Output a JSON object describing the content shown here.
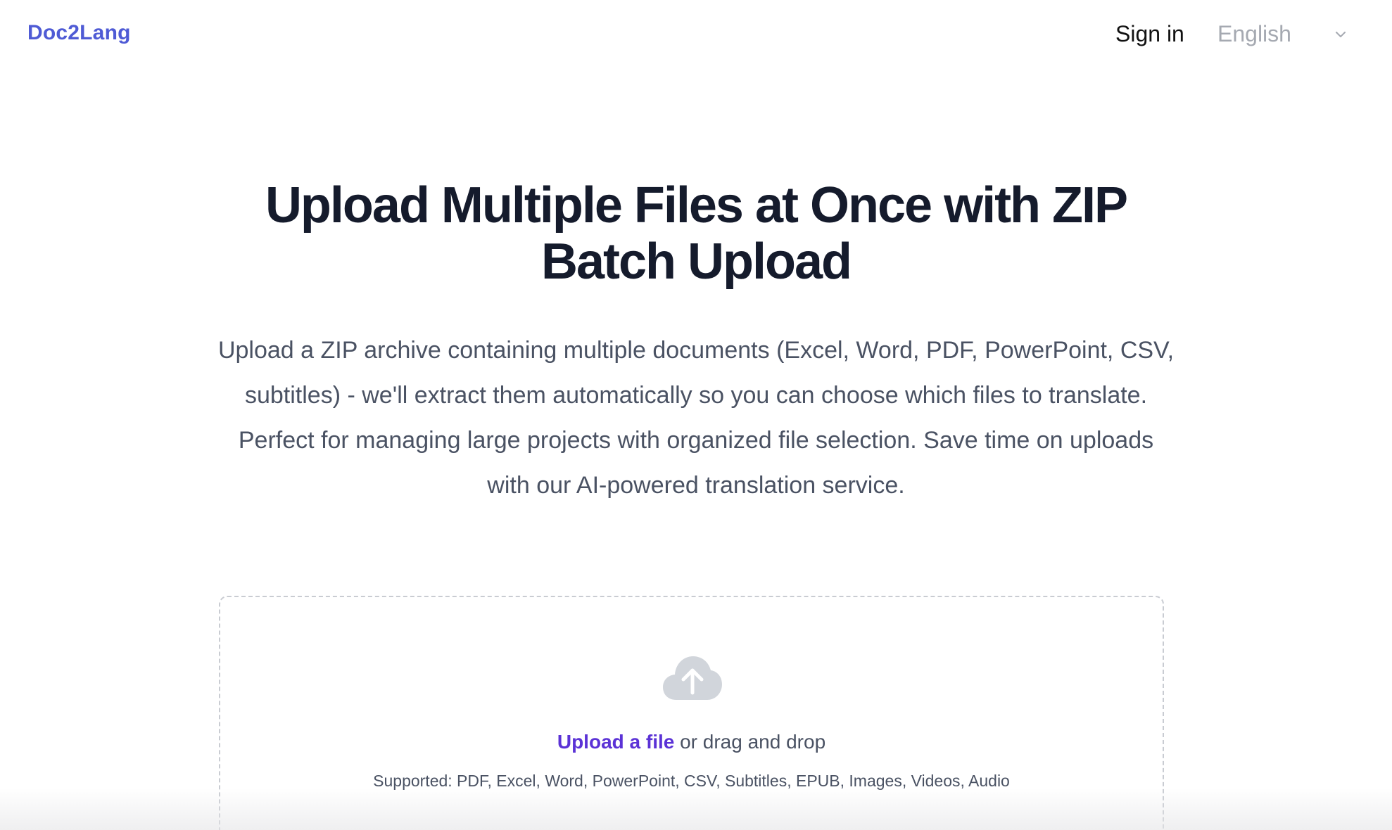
{
  "header": {
    "brand": "Doc2Lang",
    "sign_in": "Sign in",
    "language": {
      "selected": "English",
      "icon": "chevron-down-icon"
    }
  },
  "hero": {
    "title": "Upload Multiple Files at Once with ZIP Batch Upload",
    "description": "Upload a ZIP archive containing multiple documents (Excel, Word, PDF, PowerPoint, CSV, subtitles) - we'll extract them automatically so you can choose which files to translate. Perfect for managing large projects with organized file selection. Save time on uploads with our AI-powered translation service."
  },
  "upload": {
    "icon": "cloud-upload-icon",
    "link_label": "Upload a file",
    "drag_text": " or drag and drop",
    "supported": "Supported: PDF, Excel, Word, PowerPoint, CSV, Subtitles, EPUB, Images, Videos, Audio"
  },
  "colors": {
    "brand": "#4f5bd5",
    "upload_link": "#5b32d6",
    "title": "#151b2c",
    "body_text": "#4a5263",
    "muted": "#a5a9b1",
    "icon": "#d1d5db"
  }
}
